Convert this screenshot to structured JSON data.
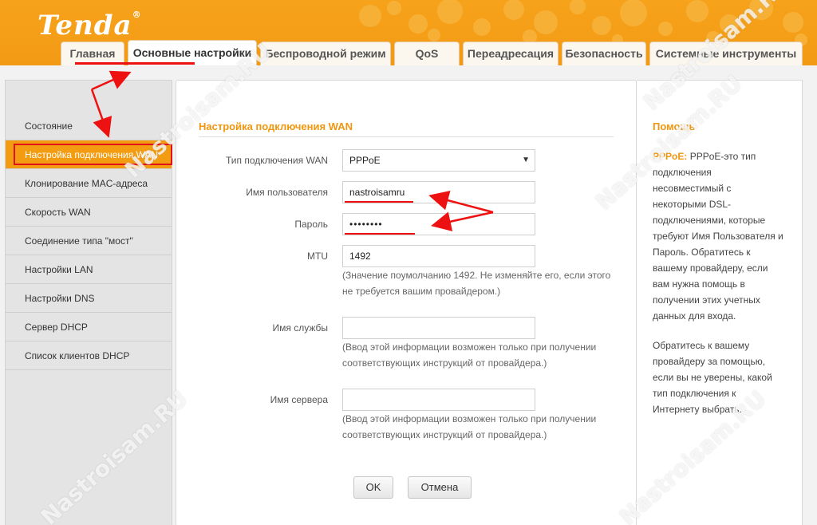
{
  "brand": {
    "logo": "Tenda",
    "reg": "®"
  },
  "tabs": [
    {
      "label": "Главная"
    },
    {
      "label": "Основные настройки"
    },
    {
      "label": "Беспроводной режим"
    },
    {
      "label": "QoS"
    },
    {
      "label": "Переадресация"
    },
    {
      "label": "Безопасность"
    },
    {
      "label": "Системные инструменты"
    }
  ],
  "sidebar": {
    "items": [
      {
        "label": "Состояние"
      },
      {
        "label": "Настройка подключения WAN"
      },
      {
        "label": "Клонирование MAC-адреса"
      },
      {
        "label": "Скорость WAN"
      },
      {
        "label": "Соединение типа \"мост\""
      },
      {
        "label": "Настройки LAN"
      },
      {
        "label": "Настройки DNS"
      },
      {
        "label": "Сервер DHCP"
      },
      {
        "label": "Список клиентов DHCP"
      }
    ]
  },
  "form": {
    "title": "Настройка подключения WAN",
    "wan_type": {
      "label": "Тип подключения WAN",
      "value": "PPPoE"
    },
    "username": {
      "label": "Имя пользователя",
      "value": "nastroisamru"
    },
    "password": {
      "label": "Пароль",
      "value": "••••••••"
    },
    "mtu": {
      "label": "MTU",
      "value": "1492",
      "note1": "(Значение поумолчанию 1492. Не изменяйте его, если этого",
      "note2": "не требуется вашим провайдером.)"
    },
    "service": {
      "label": "Имя службы",
      "value": "",
      "note1": "(Ввод этой информации возможен только при получении",
      "note2": "соответствующих инструкций от провайдера.)"
    },
    "server": {
      "label": "Имя сервера",
      "value": "",
      "note1": "(Ввод этой информации возможен только при получении",
      "note2": "соответствующих инструкций от провайдера.)"
    },
    "ok_label": "OK",
    "cancel_label": "Отмена"
  },
  "help": {
    "title": "Помощь",
    "pppoe_prefix": "PPPoE:",
    "lines1": [
      "PPPoE-это тип",
      "подключения",
      "несовместимый с",
      "некоторыми DSL-",
      "подключениями, которые",
      "требуют Имя Пользователя и",
      "Пароль. Обратитесь к",
      "вашему провайдеру, если",
      "вам нужна помощь в",
      "получении этих учетных",
      "данных для входа."
    ],
    "lines2": [
      "Обратитесь к вашему",
      "провайдеру за помощью,",
      "если вы не уверены, какой",
      "тип подключения к",
      "Интернету выбрать."
    ]
  },
  "watermark": "Nastroisam.RU",
  "colors": {
    "accent": "#f39c12",
    "annotation": "#e11111"
  }
}
